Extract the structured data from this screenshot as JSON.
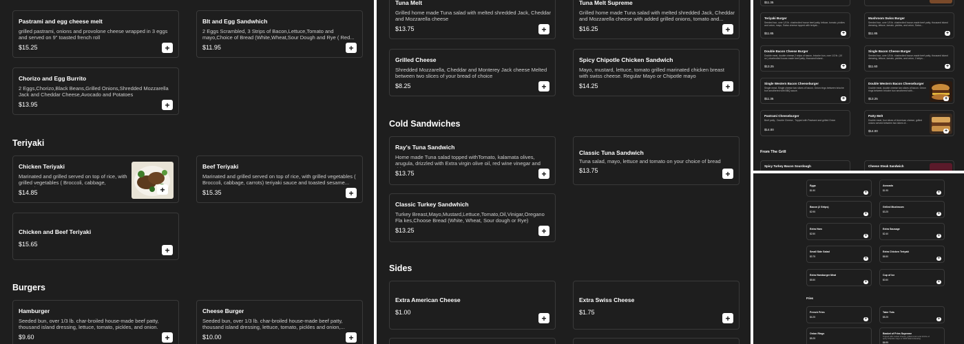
{
  "panel1": {
    "sections": [
      {
        "title": "Teriyaki"
      },
      {
        "title": "Burgers"
      }
    ],
    "items": [
      {
        "name": "Pastrami and egg cheese melt",
        "desc": "grilled pastrami, onions and provolone cheese wrapped in 3 eggs and served on 9\" toasted french roll",
        "price": "$15.25"
      },
      {
        "name": "Blt and Egg Sandwhich",
        "desc": "2 Eggs Scrambled, 3 Strips of Bacon,Lettuce,Tomato and mayo,Choice of Bread (White,Wheat,Sour Dough and Rye ( Red...",
        "price": "$11.95"
      },
      {
        "name": "Chorizo and Egg Burrito",
        "desc": "2 Eggs,Chorizo,Black Beans,Grilled Onions,Shredded Mozzarella Jack and Cheddar Cheese,Avocado and Potatoes",
        "price": "$13.95"
      },
      {
        "name": "Chicken Teriyaki",
        "desc": "Marinated and grilled served on top of rice, with grilled vegetables ( Broccoli, cabbage, carrots)...",
        "price": "$14.85"
      },
      {
        "name": "Beef Teriyaki",
        "desc": "Marinated and grilled served on top of rice, with grilled vegetables ( Broccoli, cabbage, carrots) teriyaki sauce and toasted sesame...",
        "price": "$15.35"
      },
      {
        "name": "Chicken and Beef Teriyaki",
        "desc": "",
        "price": "$15.65"
      },
      {
        "name": "Hamburger",
        "desc": "Seeded bun, over 1/3 lb. char-broiled house-made beef patty, thousand island dressing, lettuce, tomato, pickles, and onion.",
        "price": "$9.60"
      },
      {
        "name": "Cheese Burger",
        "desc": "Seeded bun, over 1/3 lb. char-broiled house-made beef patty, thousand island dressing, lettuce, tomato, pickles and onion,...",
        "price": "$10.00"
      }
    ]
  },
  "panel2": {
    "sections": [
      {
        "title": "Cold Sandwiches"
      },
      {
        "title": "Sides"
      }
    ],
    "items": [
      {
        "name": "Tuna Melt",
        "desc": "Grilled home made Tuna salad with melted shredded Jack, Cheddar and Mozzarella cheese",
        "price": "$13.75"
      },
      {
        "name": "Tuna Melt Supreme",
        "desc": "Grilled home made Tuna salad with melted shredded Jack, Cheddar and Mozzarella cheese with added grilled onions, tomato and...",
        "price": "$16.25"
      },
      {
        "name": "Grilled Cheese",
        "desc": "Shredded Mozzarella, Cheddar and Monterey Jack cheese Melted between two slices of your bread of choice",
        "price": "$8.25"
      },
      {
        "name": "Spicy Chipotle Chicken Sandwich",
        "desc": "Mayo, mustard, lettuce, tomato grilled marinated chicken breast with swiss cheese. Regular Mayo or Chipotle mayo",
        "price": "$14.25"
      },
      {
        "name": "Ray's Tuna Sandwich",
        "desc": "Home made Tuna salad topped withTomato, kalamata olives, arugula, drizzled with Extra virgin olive oil, red wine vinegar and drie...",
        "price": "$13.75"
      },
      {
        "name": "Classic Tuna Sandwich",
        "desc": "Tuna salad, mayo, lettuce and tomato on your choice of bread",
        "price": "$13.75"
      },
      {
        "name": "Classic Turkey Sandwhich",
        "desc": "Turkey Breast,Mayo,Mustard,Lettuce,Tomato,Oil,Vinigar,Oregano Fla kes,Choose Bread (White, Wheat, Sour dough or Rye)",
        "price": "$13.25"
      },
      {
        "name": "Extra American Cheese",
        "desc": "",
        "price": "$1.00"
      },
      {
        "name": "Extra Swiss Cheese",
        "desc": "",
        "price": "$1.75"
      }
    ]
  },
  "panel3": {
    "section": "From The Grill",
    "items": [
      {
        "name": "",
        "desc": "",
        "price": "$11.35"
      },
      {
        "name": "",
        "desc": "",
        "price": ""
      },
      {
        "name": "Teriyaki Burger",
        "desc": "Seeded bun, over 1/3 lb. charbroiled house beef patty, lettuce, tomato, pickles and onion, mayo, Swiss cheese topped with teriyak...",
        "price": "$11.85"
      },
      {
        "name": "Mushroom Swiss Burger",
        "desc": "Seeded bun, over 1/3 lb. charbroiled house-made beef patty, thousand island dressing, lettuce, tomato, pickles, and onion, Swiss...",
        "price": "$11.85"
      },
      {
        "name": "Double Bacon Cheese Burger",
        "desc": "Double meat, double cheese,2 strips of bacon, brioche bun, over 1/2 lb. (10 oz.) charbroiled house-made beef patty, thousand island...",
        "price": "$13.25"
      },
      {
        "name": "Single Bacon Cheese Burger",
        "desc": "Seeded bun, over 1/3 lb. charbroiled house-made beef patty, thousand island dressing, lettuce, tomato, pickles, and onion, 2 strips...",
        "price": "$11.60"
      },
      {
        "name": "Single Western Bacon Cheeseburger",
        "desc": "Single meat, Single cheese two slices of bacon. Onion rings between brioche bun smothered with BBQ sauce.",
        "price": "$11.35"
      },
      {
        "name": "Double Western Bacon Cheeseburger",
        "desc": "Double meat, double cheese two slices of bacon. Onion rings between brioche bun smothered with...",
        "price": "$13.25"
      },
      {
        "name": "Pastrami Cheeseburger",
        "desc": "Beef patty , Double Cheese , Topped with Pastrami and grilled Onion",
        "price": "$14.00"
      },
      {
        "name": "Patty Melt",
        "desc": "Double meat, four slices of American cheese, grilled onions served between two slices of...",
        "price": "$14.00"
      },
      {
        "name": "Spicy Turkey Bacon Sourdough",
        "desc": "",
        "price": ""
      },
      {
        "name": "Cheese Steak Sandwich",
        "desc": "",
        "price": ""
      }
    ]
  },
  "panel4": {
    "section": "Fries",
    "items": [
      {
        "name": "Eggs",
        "price": "$1.50"
      },
      {
        "name": "Avocado",
        "price": "$1.95"
      },
      {
        "name": "Bacon (2 Strips)",
        "price": "$2.95"
      },
      {
        "name": "Grilled Mushroom",
        "price": "$3.25"
      },
      {
        "name": "Extra Ham",
        "price": "$2.50"
      },
      {
        "name": "Extra Sausage",
        "price": "$2.40"
      },
      {
        "name": "Small Side Salad",
        "price": "$3.75"
      },
      {
        "name": "Extra Chicken Teriyaki",
        "price": "$6.50"
      },
      {
        "name": "Extra Hamburger Meat",
        "price": "$5.50"
      },
      {
        "name": "Cup of Ice",
        "price": "$0.50"
      },
      {
        "name": "French Fries",
        "price": "$4.25"
      },
      {
        "name": "Tater Tots",
        "price": "$5.25"
      },
      {
        "name": "Onion Rings",
        "price": "$5.25"
      },
      {
        "name": "Basket of Fries Supreme",
        "desc": "Topped with melted cheese, grilled onion and drizzle of spicy Chipotle mayo or 1000 Island dressing",
        "price": "$6.95"
      }
    ]
  },
  "ui": {
    "add_label": "+"
  },
  "colors": {
    "background": "#1e1e1e",
    "card_border": "#3a3a3a",
    "button": "#ffffff"
  }
}
